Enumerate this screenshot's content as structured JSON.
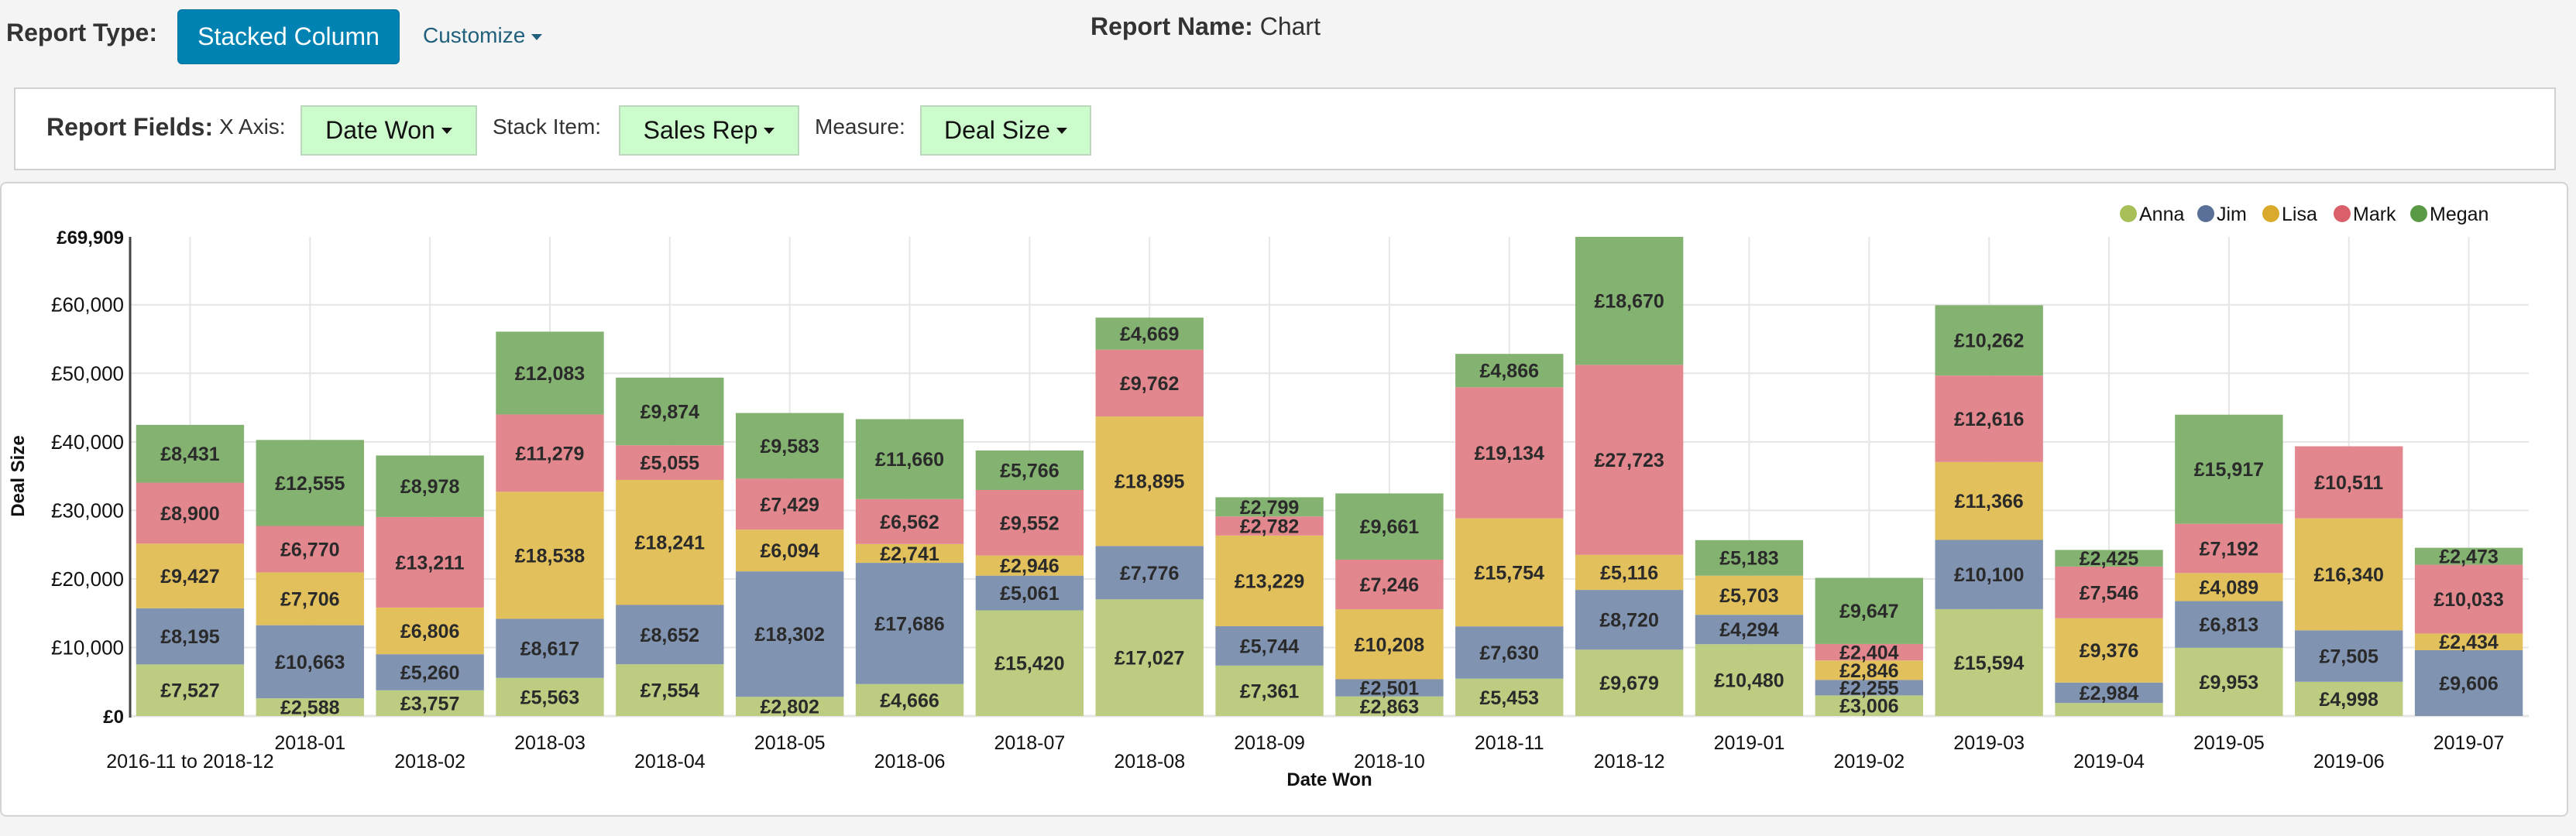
{
  "header": {
    "report_type_label": "Report Type:",
    "report_type_value": "Stacked Column",
    "customize_label": "Customize",
    "report_name_label": "Report Name:",
    "report_name_value": "Chart"
  },
  "fields": {
    "title": "Report Fields:",
    "x_axis_label": "X Axis:",
    "x_axis_value": "Date Won",
    "stack_label": "Stack Item:",
    "stack_value": "Sales Rep",
    "measure_label": "Measure:",
    "measure_value": "Deal Size"
  },
  "chart_data": {
    "type": "bar",
    "stacked": true,
    "title": "",
    "xlabel": "Date Won",
    "ylabel": "Deal Size",
    "ylim": [
      0,
      69909
    ],
    "yticks": [
      0,
      10000,
      20000,
      30000,
      40000,
      50000,
      60000,
      69909
    ],
    "ytick_labels": [
      "£0",
      "£10,000",
      "£20,000",
      "£30,000",
      "£40,000",
      "£50,000",
      "£60,000",
      "£69,909"
    ],
    "grid": true,
    "legend_position": "top-right",
    "currency_symbol": "£",
    "categories": [
      "2016-11 to 2018-12",
      "2018-01",
      "2018-02",
      "2018-03",
      "2018-04",
      "2018-05",
      "2018-06",
      "2018-07",
      "2018-08",
      "2018-09",
      "2018-10",
      "2018-11",
      "2018-12",
      "2019-01",
      "2019-02",
      "2019-03",
      "2019-04",
      "2019-05",
      "2019-06",
      "2019-07"
    ],
    "series": [
      {
        "name": "Anna",
        "color": "#a8bf5a",
        "fill": "#bccd82",
        "values": [
          7527,
          2588,
          3757,
          5563,
          7554,
          2802,
          4666,
          15420,
          17027,
          7361,
          2863,
          5453,
          9679,
          10480,
          3006,
          15594,
          1900,
          9953,
          4998,
          0
        ],
        "labeled": [
          true,
          true,
          true,
          true,
          true,
          true,
          true,
          true,
          true,
          true,
          true,
          true,
          true,
          true,
          true,
          true,
          false,
          true,
          true,
          false
        ]
      },
      {
        "name": "Jim",
        "color": "#5a7099",
        "fill": "#8093b1",
        "values": [
          8195,
          10663,
          5260,
          8617,
          8652,
          18302,
          17686,
          5061,
          7776,
          5744,
          2501,
          7630,
          8720,
          4294,
          2255,
          10100,
          2984,
          6813,
          7505,
          9606
        ]
      },
      {
        "name": "Lisa",
        "color": "#d9aa2c",
        "fill": "#e2c05c",
        "values": [
          9427,
          7706,
          6806,
          18538,
          18241,
          6094,
          2741,
          2946,
          18895,
          13229,
          10208,
          15754,
          5116,
          5703,
          2846,
          11366,
          9376,
          4089,
          16340,
          2434
        ]
      },
      {
        "name": "Mark",
        "color": "#d9606b",
        "fill": "#e3878e",
        "values": [
          8900,
          6770,
          13211,
          11279,
          5055,
          7429,
          6562,
          9552,
          9762,
          2782,
          7246,
          19134,
          27723,
          0,
          2404,
          12616,
          7546,
          7192,
          10511,
          10033
        ]
      },
      {
        "name": "Megan",
        "color": "#5a9a46",
        "fill": "#84b271",
        "values": [
          8431,
          12555,
          8978,
          12083,
          9874,
          9583,
          11660,
          5766,
          4669,
          2799,
          9661,
          4866,
          18670,
          5183,
          9647,
          10262,
          2425,
          15917,
          0,
          2473
        ]
      }
    ]
  }
}
